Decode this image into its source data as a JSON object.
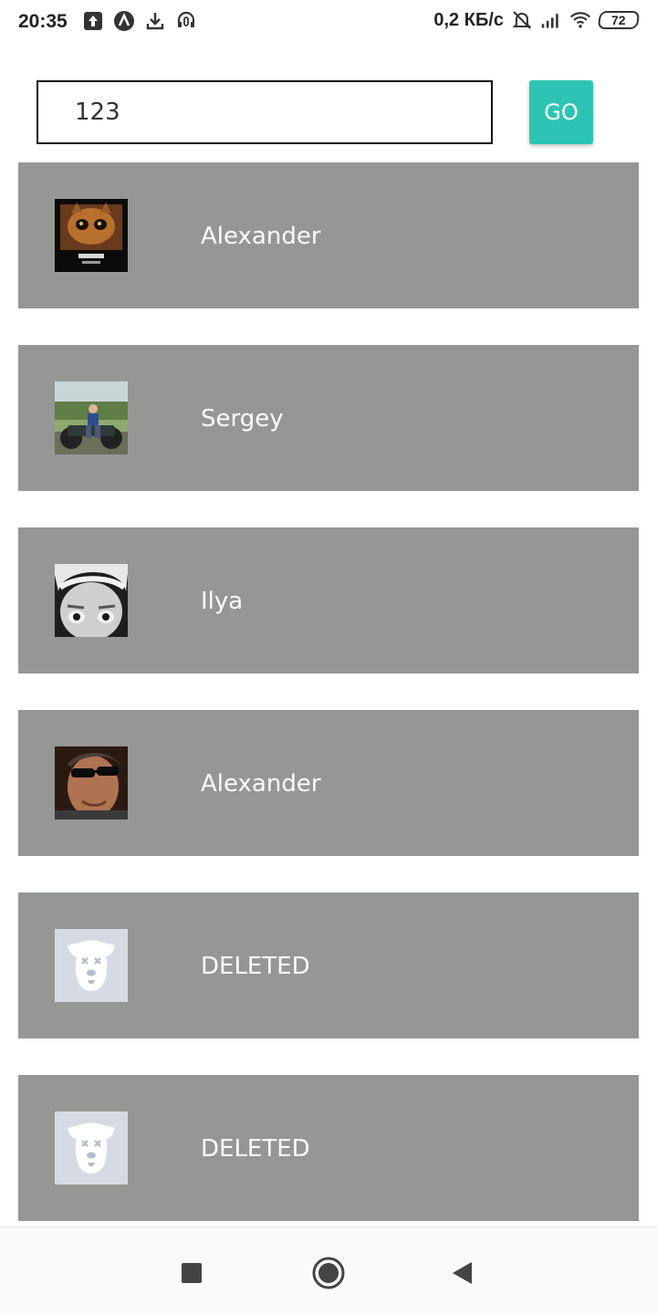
{
  "status_bar": {
    "time": "20:35",
    "network_speed": "0,2 КБ/с",
    "battery": "72",
    "icons": [
      "upload-icon",
      "app-logo-icon",
      "download-icon",
      "headset-icon",
      "mute-bell-icon",
      "signal-icon",
      "wifi-icon",
      "battery-icon"
    ]
  },
  "search": {
    "value": "123",
    "go_label": "GO",
    "accent_color": "#2ec4b3"
  },
  "list": {
    "row_color": "#949794",
    "items": [
      {
        "name": "Alexander",
        "avatar": "cat-photo"
      },
      {
        "name": "Sergey",
        "avatar": "atv-photo"
      },
      {
        "name": "Ilya",
        "avatar": "einstein-photo"
      },
      {
        "name": "Alexander",
        "avatar": "sunglasses-photo"
      },
      {
        "name": "DELETED",
        "avatar": "deleted-dog-icon"
      },
      {
        "name": "DELETED",
        "avatar": "deleted-dog-icon"
      }
    ]
  },
  "navigation": {
    "buttons": [
      "recents-icon",
      "home-icon",
      "back-icon"
    ]
  }
}
